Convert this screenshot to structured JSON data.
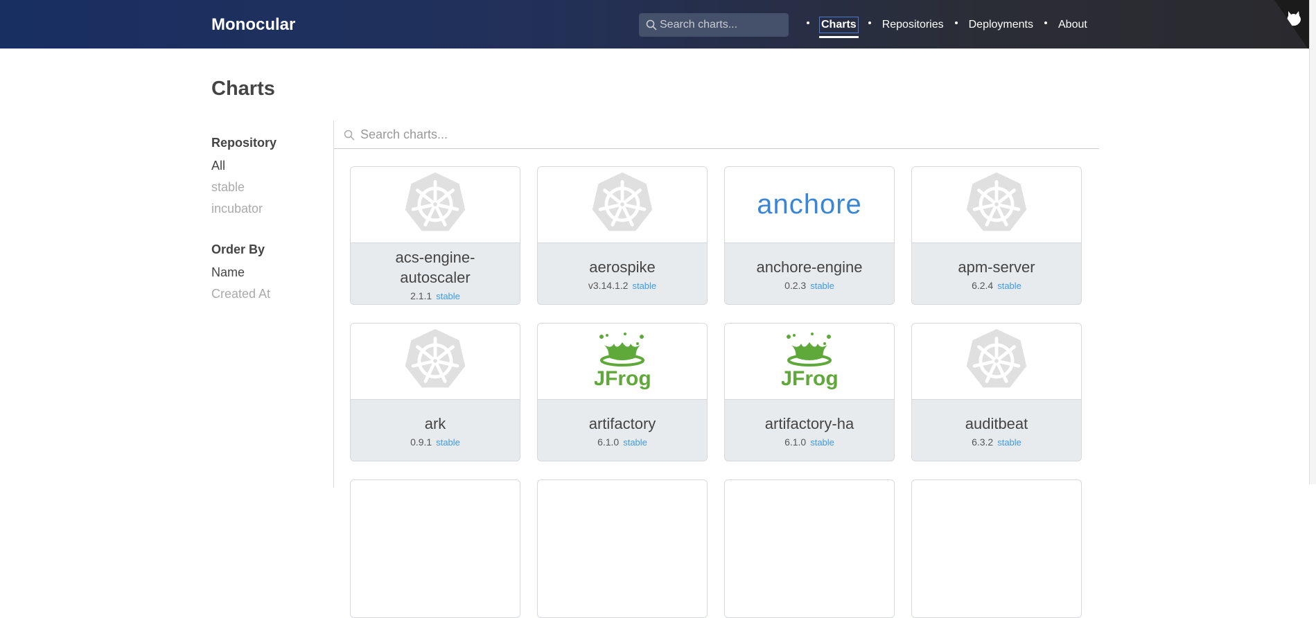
{
  "header": {
    "brand": "Monocular",
    "search_placeholder": "Search charts...",
    "nav": [
      {
        "label": "Charts",
        "active": true
      },
      {
        "label": "Repositories"
      },
      {
        "label": "Deployments"
      },
      {
        "label": "About"
      }
    ]
  },
  "page": {
    "title": "Charts",
    "search_placeholder": "Search charts..."
  },
  "sidebar": {
    "repository": {
      "title": "Repository",
      "items": [
        {
          "label": "All",
          "selected": true
        },
        {
          "label": "stable"
        },
        {
          "label": "incubator"
        }
      ]
    },
    "order_by": {
      "title": "Order By",
      "items": [
        {
          "label": "Name",
          "selected": true
        },
        {
          "label": "Created At"
        }
      ]
    }
  },
  "charts": [
    {
      "name": "acs-engine-autoscaler",
      "version": "2.1.1",
      "repo": "stable",
      "icon": "kubernetes-icon"
    },
    {
      "name": "aerospike",
      "version": "v3.14.1.2",
      "repo": "stable",
      "icon": "kubernetes-icon"
    },
    {
      "name": "anchore-engine",
      "version": "0.2.3",
      "repo": "stable",
      "icon": "anchore-logo",
      "logo_text": "anchore"
    },
    {
      "name": "apm-server",
      "version": "6.2.4",
      "repo": "stable",
      "icon": "kubernetes-icon"
    },
    {
      "name": "ark",
      "version": "0.9.1",
      "repo": "stable",
      "icon": "kubernetes-icon"
    },
    {
      "name": "artifactory",
      "version": "6.1.0",
      "repo": "stable",
      "icon": "jfrog-logo",
      "logo_text": "JFrog"
    },
    {
      "name": "artifactory-ha",
      "version": "6.1.0",
      "repo": "stable",
      "icon": "jfrog-logo",
      "logo_text": "JFrog"
    },
    {
      "name": "auditbeat",
      "version": "6.3.2",
      "repo": "stable",
      "icon": "kubernetes-icon"
    }
  ],
  "colors": {
    "accent": "#3d9ae8",
    "header_start": "#182f62",
    "header_end": "#2a2a2e",
    "jfrog": "#5fa83a",
    "anchore": "#3a86d6"
  }
}
